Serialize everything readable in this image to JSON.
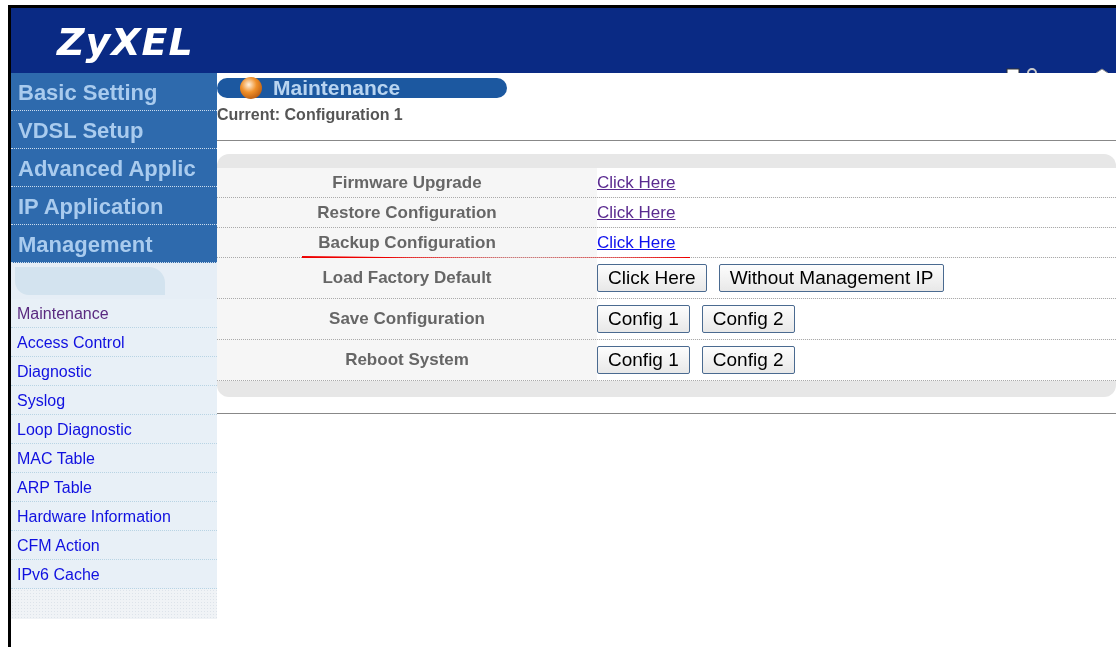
{
  "header": {
    "logo": "ZyXEL"
  },
  "main_menu": [
    {
      "label": "Basic Setting"
    },
    {
      "label": "VDSL Setup"
    },
    {
      "label": "Advanced Applic"
    },
    {
      "label": "IP Application"
    },
    {
      "label": "Management"
    }
  ],
  "sub_menu": [
    {
      "label": "Maintenance",
      "selected": true
    },
    {
      "label": "Access Control",
      "selected": false
    },
    {
      "label": "Diagnostic",
      "selected": false
    },
    {
      "label": "Syslog",
      "selected": false
    },
    {
      "label": "Loop Diagnostic",
      "selected": false
    },
    {
      "label": "MAC Table",
      "selected": false
    },
    {
      "label": "ARP Table",
      "selected": false
    },
    {
      "label": "Hardware Information",
      "selected": false
    },
    {
      "label": "CFM Action",
      "selected": false
    },
    {
      "label": "IPv6 Cache",
      "selected": false
    }
  ],
  "page_title": "Maintenance",
  "current": "Current: Configuration 1",
  "rows": [
    {
      "label": "Firmware Upgrade",
      "kind": "link",
      "link": {
        "label": "Click Here",
        "visited": true
      },
      "underlined": false
    },
    {
      "label": "Restore Configuration",
      "kind": "link",
      "link": {
        "label": "Click Here",
        "visited": true
      },
      "underlined": false
    },
    {
      "label": "Backup Configuration",
      "kind": "link",
      "link": {
        "label": "Click Here",
        "visited": false
      },
      "underlined": true
    },
    {
      "label": "Load Factory Default",
      "kind": "buttons",
      "buttons": [
        "Click Here",
        "Without Management IP"
      ],
      "underlined": false
    },
    {
      "label": "Save Configuration",
      "kind": "buttons",
      "buttons": [
        "Config 1",
        "Config 2"
      ],
      "underlined": false
    },
    {
      "label": "Reboot System",
      "kind": "buttons",
      "buttons": [
        "Config 1",
        "Config 2"
      ],
      "underlined": false
    }
  ]
}
